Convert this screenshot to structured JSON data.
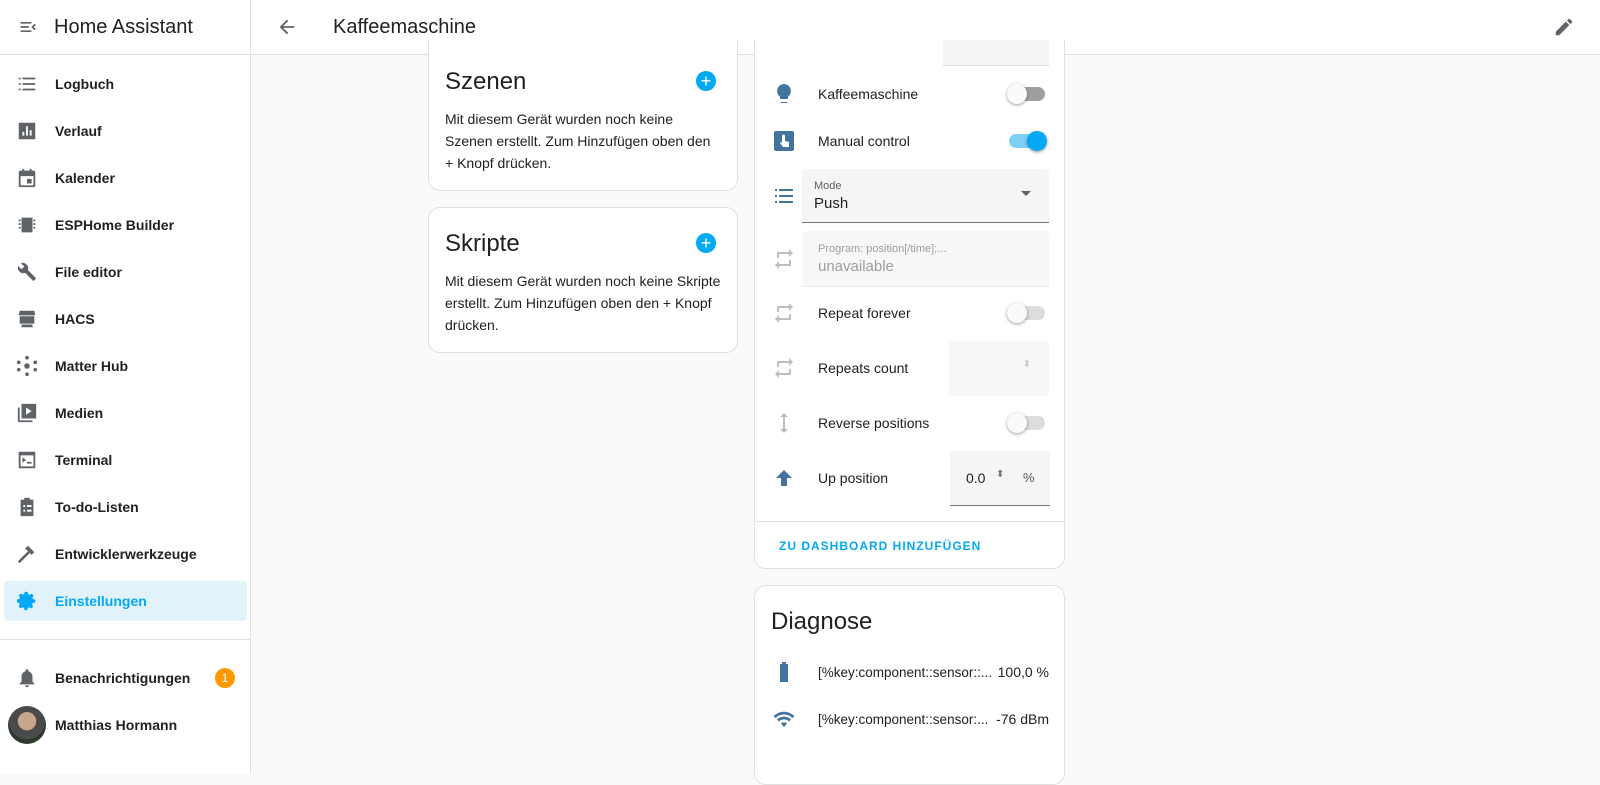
{
  "app_title": "Home Assistant",
  "sidebar": {
    "items": [
      {
        "label": "Logbuch",
        "icon": "list-icon"
      },
      {
        "label": "Verlauf",
        "icon": "chart-icon"
      },
      {
        "label": "Kalender",
        "icon": "calendar-icon"
      },
      {
        "label": "ESPHome Builder",
        "icon": "chip-icon"
      },
      {
        "label": "File editor",
        "icon": "wrench-icon"
      },
      {
        "label": "HACS",
        "icon": "hacs-icon"
      },
      {
        "label": "Matter Hub",
        "icon": "hub-icon"
      },
      {
        "label": "Medien",
        "icon": "media-icon"
      },
      {
        "label": "Terminal",
        "icon": "terminal-icon"
      },
      {
        "label": "To-do-Listen",
        "icon": "clipboard-icon"
      },
      {
        "label": "Entwicklerwerkzeuge",
        "icon": "hammer-icon"
      },
      {
        "label": "Einstellungen",
        "icon": "gear-icon"
      }
    ],
    "notifications": {
      "label": "Benachrichtigungen",
      "count": "1"
    },
    "user": "Matthias Hormann"
  },
  "header": {
    "title": "Kaffeemaschine"
  },
  "scenes": {
    "title": "Szenen",
    "text": "Mit diesem Gerät wurden noch keine Szenen erstellt. Zum Hinzufügen oben den + Knopf drücken."
  },
  "scripts": {
    "title": "Skripte",
    "text": "Mit diesem Gerät wurden noch keine Skripte erstellt. Zum Hinzufügen oben den + Knopf drücken."
  },
  "controls": {
    "switch1": {
      "label": "Kaffeemaschine",
      "on": false
    },
    "switch2": {
      "label": "Manual control",
      "on": true
    },
    "mode": {
      "label": "Mode",
      "value": "Push"
    },
    "program": {
      "label": "Program: position[/time];...",
      "value": "unavailable"
    },
    "repeat": {
      "label": "Repeat forever",
      "on": false
    },
    "repeats_count": {
      "label": "Repeats count"
    },
    "reverse": {
      "label": "Reverse positions",
      "on": false
    },
    "up": {
      "label": "Up position",
      "value": "0.0",
      "unit": "%"
    },
    "add_dashboard": "ZU DASHBOARD HINZUFÜGEN"
  },
  "diagnose": {
    "title": "Diagnose",
    "rows": [
      {
        "label": "[%key:component::sensor::...",
        "value": "100,0 %"
      },
      {
        "label": "[%key:component::sensor:...",
        "value": "-76 dBm"
      }
    ]
  },
  "colors": {
    "accent": "#03a9f4",
    "icon": "#44739e"
  }
}
